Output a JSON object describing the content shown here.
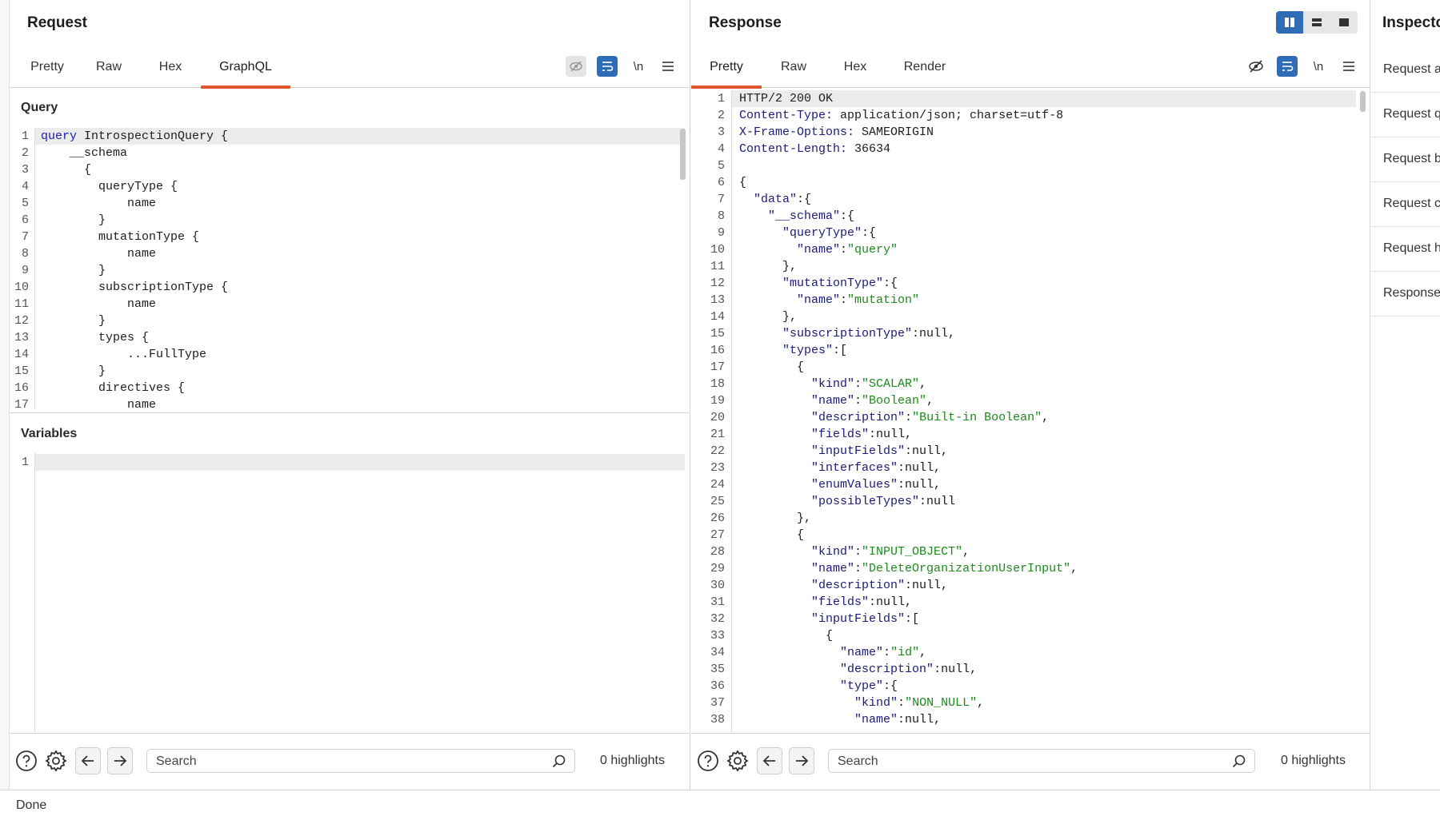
{
  "request": {
    "title": "Request",
    "tabs": [
      "Pretty",
      "Raw",
      "Hex",
      "GraphQL"
    ],
    "active_tab": "GraphQL",
    "tools": {
      "newline": "\\n"
    },
    "query_label": "Query",
    "variables_label": "Variables",
    "query_lines": [
      "query IntrospectionQuery {",
      "    __schema",
      "      {",
      "        queryType {",
      "            name",
      "        }",
      "        mutationType {",
      "            name",
      "        }",
      "        subscriptionType {",
      "            name",
      "        }",
      "        types {",
      "            ...FullType",
      "        }",
      "        directives {",
      "            name"
    ],
    "variables_lines": [
      ""
    ],
    "search_placeholder": "Search",
    "highlights": "0 highlights"
  },
  "response": {
    "title": "Response",
    "tabs": [
      "Pretty",
      "Raw",
      "Hex",
      "Render"
    ],
    "active_tab": "Pretty",
    "tools": {
      "newline": "\\n"
    },
    "lines": [
      "HTTP/2 200 OK",
      "Content-Type: application/json; charset=utf-8",
      "X-Frame-Options: SAMEORIGIN",
      "Content-Length: 36634",
      "",
      "{",
      "  \"data\":{",
      "    \"__schema\":{",
      "      \"queryType\":{",
      "        \"name\":\"query\"",
      "      },",
      "      \"mutationType\":{",
      "        \"name\":\"mutation\"",
      "      },",
      "      \"subscriptionType\":null,",
      "      \"types\":[",
      "        {",
      "          \"kind\":\"SCALAR\",",
      "          \"name\":\"Boolean\",",
      "          \"description\":\"Built-in Boolean\",",
      "          \"fields\":null,",
      "          \"inputFields\":null,",
      "          \"interfaces\":null,",
      "          \"enumValues\":null,",
      "          \"possibleTypes\":null",
      "        },",
      "        {",
      "          \"kind\":\"INPUT_OBJECT\",",
      "          \"name\":\"DeleteOrganizationUserInput\",",
      "          \"description\":null,",
      "          \"fields\":null,",
      "          \"inputFields\":[",
      "            {",
      "              \"name\":\"id\",",
      "              \"description\":null,",
      "              \"type\":{",
      "                \"kind\":\"NON_NULL\",",
      "                \"name\":null,"
    ],
    "search_placeholder": "Search",
    "highlights": "0 highlights"
  },
  "inspector": {
    "title": "Inspector",
    "rows": [
      "Request attributes",
      "Request query parameters",
      "Request body parameters",
      "Request cookies",
      "Request headers",
      "Response headers"
    ]
  },
  "status": {
    "text": "Done"
  },
  "colors": {
    "accent": "#e0552b",
    "active_tool": "#2f6cb3",
    "string": "#1c8b1c",
    "keyword": "#2020b0"
  }
}
